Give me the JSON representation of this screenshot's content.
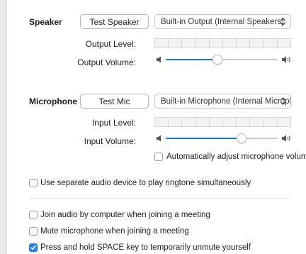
{
  "speaker": {
    "label": "Speaker",
    "test_button": "Test Speaker",
    "device": "Built-in Output (Internal Speakers)",
    "output_level_label": "Output Level:",
    "output_volume_label": "Output Volume:",
    "output_volume": 0.46,
    "meter_segments": 10
  },
  "microphone": {
    "label": "Microphone",
    "test_button": "Test Mic",
    "device": "Built-in Microphone (Internal Micropho...",
    "input_level_label": "Input Level:",
    "input_volume_label": "Input Volume:",
    "input_volume": 0.68,
    "meter_segments": 10,
    "auto_adjust_label": "Automatically adjust microphone volume",
    "auto_adjust_checked": false
  },
  "options": {
    "separate_device_label": "Use separate audio device to play ringtone simultaneously",
    "separate_device_checked": false,
    "join_audio_label": "Join audio by computer when joining a meeting",
    "join_audio_checked": false,
    "mute_mic_label": "Mute microphone when joining a meeting",
    "mute_mic_checked": false,
    "press_space_label": "Press and hold SPACE key to temporarily unmute yourself",
    "press_space_checked": true
  },
  "colors": {
    "accent": "#1c72d6",
    "checkbox_checked": "#2b7de9"
  }
}
